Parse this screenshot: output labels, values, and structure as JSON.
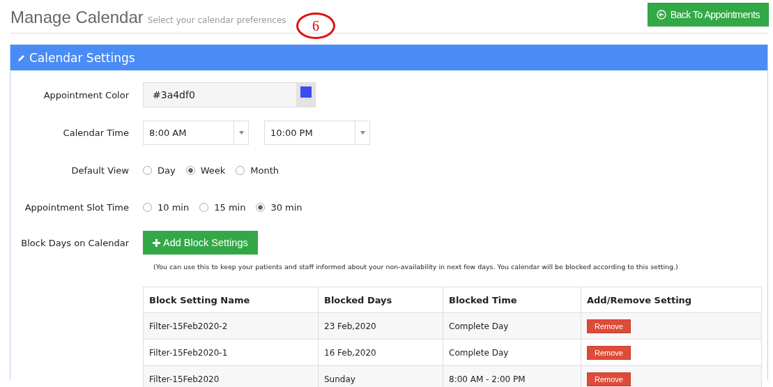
{
  "header": {
    "title": "Manage Calendar",
    "subtitle": "Select your calendar preferences",
    "annotation": "6",
    "back_button": "Back To Appointments"
  },
  "panel": {
    "title": "Calendar Settings"
  },
  "appointment_color": {
    "label": "Appointment Color",
    "value": "#3a4df0",
    "color": "#3a4df0"
  },
  "calendar_time": {
    "label": "Calendar Time",
    "start": "8:00 AM",
    "end": "10:00 PM"
  },
  "default_view": {
    "label": "Default View",
    "options": [
      {
        "label": "Day",
        "selected": false
      },
      {
        "label": "Week",
        "selected": true
      },
      {
        "label": "Month",
        "selected": false
      }
    ]
  },
  "slot_time": {
    "label": "Appointment Slot Time",
    "options": [
      {
        "label": "10 min",
        "selected": false
      },
      {
        "label": "15 min",
        "selected": false
      },
      {
        "label": "30 min",
        "selected": true
      }
    ]
  },
  "block_days": {
    "label": "Block Days on Calendar",
    "button": "Add Block Settings",
    "help": "(You can use this to keep your patients and staff informed about your non-availability in next few days. You calendar will be blocked according to this setting.)"
  },
  "table": {
    "columns": [
      "Block Setting Name",
      "Blocked Days",
      "Blocked Time",
      "Add/Remove Setting"
    ],
    "rows": [
      {
        "name": "Filter-15Feb2020-2",
        "days": "23 Feb,2020",
        "time": "Complete Day",
        "action": "Remove"
      },
      {
        "name": "Filter-15Feb2020-1",
        "days": "16 Feb,2020",
        "time": "Complete Day",
        "action": "Remove"
      },
      {
        "name": "Filter-15Feb2020",
        "days": "Sunday",
        "time": "8:00 AM - 2:00 PM",
        "action": "Remove"
      }
    ]
  }
}
